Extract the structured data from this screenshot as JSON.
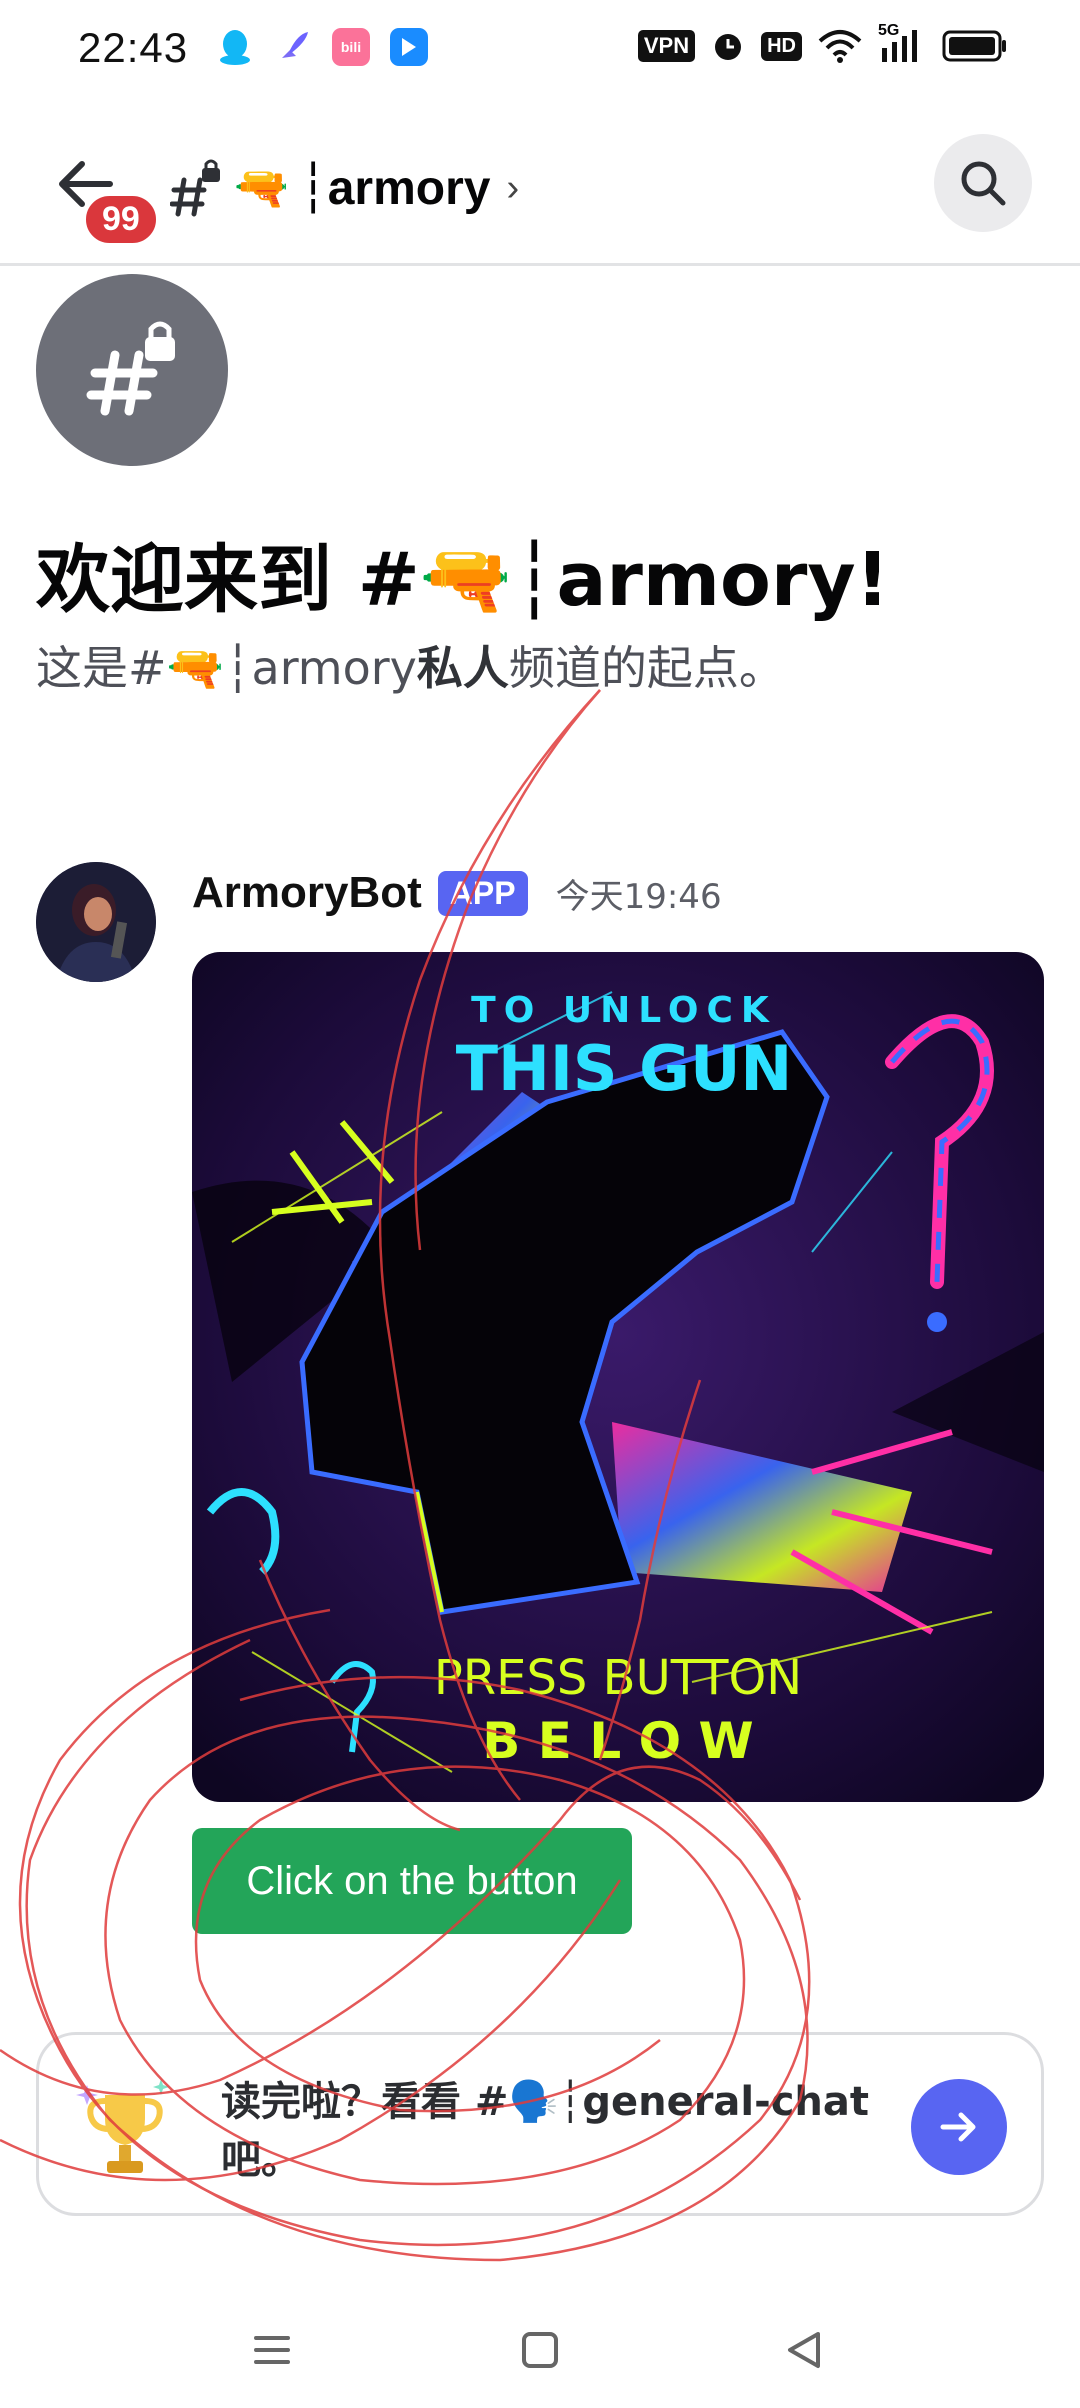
{
  "status_bar": {
    "time": "22:43",
    "vpn": "VPN",
    "hd": "HD",
    "network": "5G",
    "icons": [
      "qq-icon",
      "rocket-icon",
      "bilibili-icon",
      "app-icon",
      "alarm-icon",
      "wifi-icon",
      "signal-icon",
      "battery-icon"
    ]
  },
  "header": {
    "unread_badge": "99",
    "channel_name": "┆armory",
    "chevron": "›"
  },
  "welcome": {
    "title": "欢迎来到 #🔫┆armory!",
    "subtitle_prefix": "这是#🔫┆armory",
    "subtitle_bold": "私人",
    "subtitle_suffix": "频道的起点。"
  },
  "message": {
    "author": "ArmoryBot",
    "tag": "APP",
    "timestamp": "今天19:46",
    "image_text": {
      "line1": "TO UNLOCK",
      "line2": "THIS GUN",
      "line3": "PRESS BUTTON",
      "line4": "B E L O W"
    },
    "button_label": "Click on the button"
  },
  "composer": {
    "prompt": "读完啦？看看 #🗣️┆general-chat 吧。"
  },
  "colors": {
    "accent": "#5865f2",
    "button_green": "#23a559",
    "badge_red": "#da373c",
    "scribble_red": "#e03c3c"
  }
}
